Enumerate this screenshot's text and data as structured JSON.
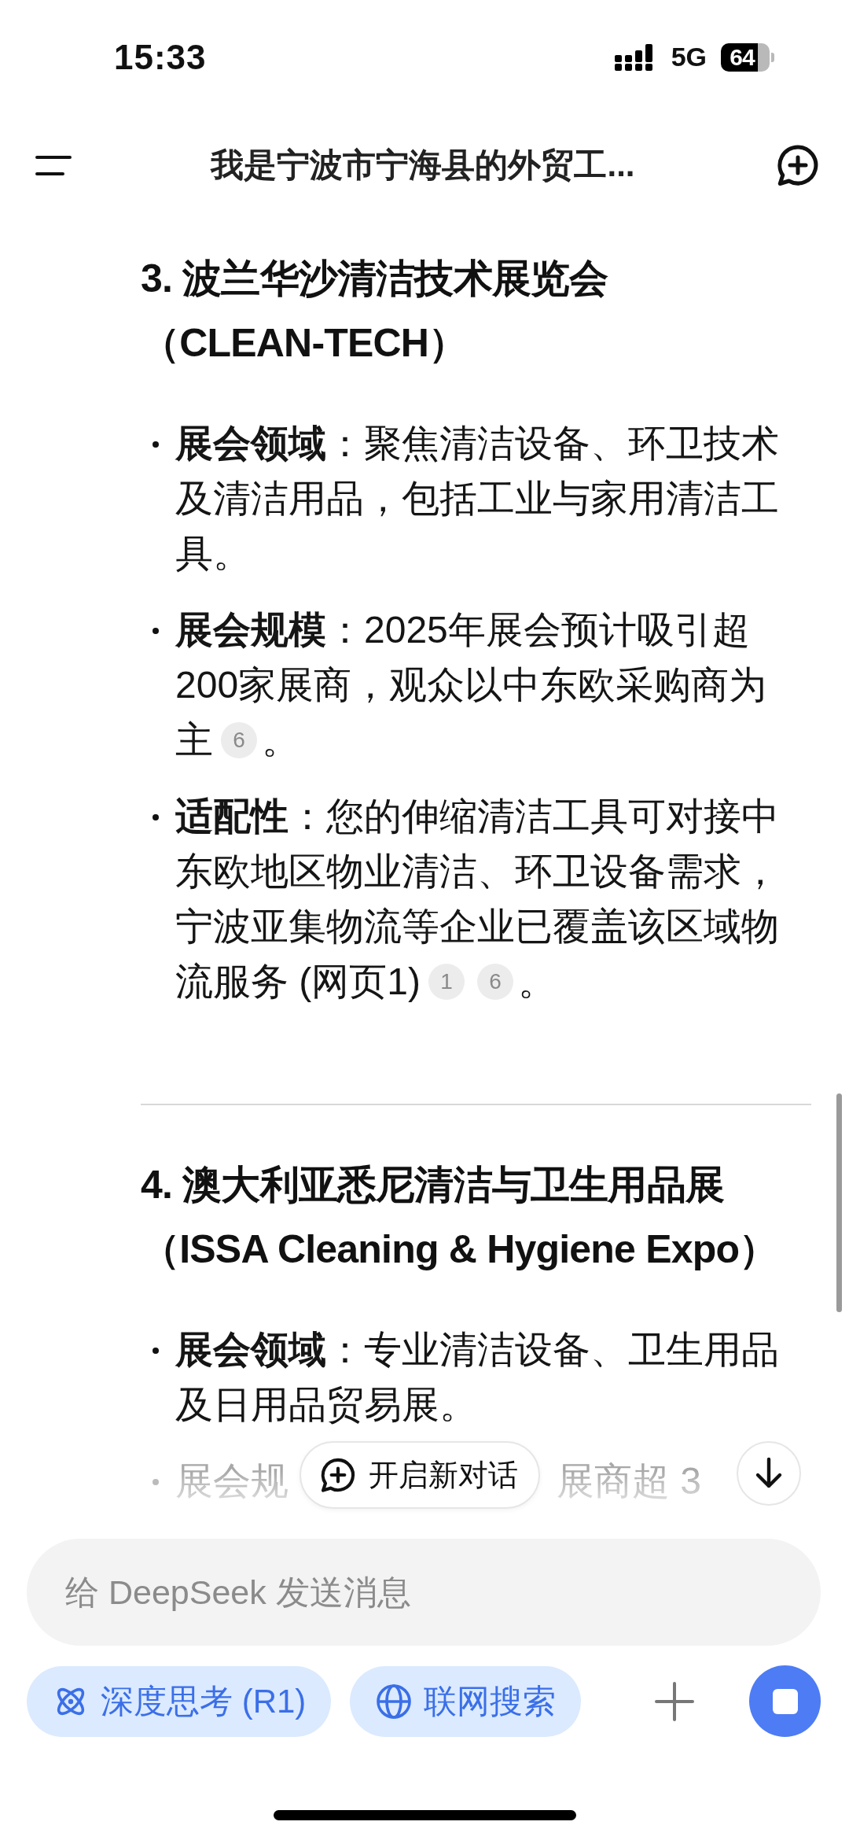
{
  "status_bar": {
    "time": "15:33",
    "network": "5G",
    "battery": "64"
  },
  "header": {
    "title": "我是宁波市宁海县的外贸工..."
  },
  "sections": [
    {
      "title": "3. 波兰华沙清洁技术展览会（CLEAN-TECH）",
      "bullets": [
        {
          "kind": "text",
          "text": "**展会领域**：聚焦清洁设备、环卫技术及清洁用品，包括工业与家用清洁工具。"
        },
        {
          "kind": "text",
          "text": "**展会规模**：2025年展会预计吸引超 200家展商，观众以中东欧采购商为主",
          "citations": [
            "6"
          ],
          "end": "。"
        },
        {
          "kind": "text",
          "text": "**适配性**：您的伸缩清洁工具可对接中东欧地区物业清洁、环卫设备需求，宁波亚集物流等企业已覆盖该区域物流服务 (网页1)",
          "citations": [
            "1",
            "6"
          ],
          "end": "。"
        }
      ]
    },
    {
      "title": "4. 澳大利亚悉尼清洁与卫生用品展（ISSA Cleaning & Hygiene Expo）",
      "bullets": [
        {
          "kind": "text",
          "text": "**展会领域**：专业清洁设备、卫生用品及日用品贸易展。"
        },
        {
          "kind": "faded",
          "fragments": [
            "展会规",
            "展商超 3"
          ]
        }
      ]
    }
  ],
  "new_chat_button": {
    "label": "开启新对话"
  },
  "composer": {
    "placeholder": "给 DeepSeek 发送消息",
    "toggles": [
      {
        "kind": "think",
        "label": "深度思考 (R1)",
        "on": true
      },
      {
        "kind": "web",
        "label": "联网搜索",
        "on": true
      }
    ],
    "generating": true
  }
}
